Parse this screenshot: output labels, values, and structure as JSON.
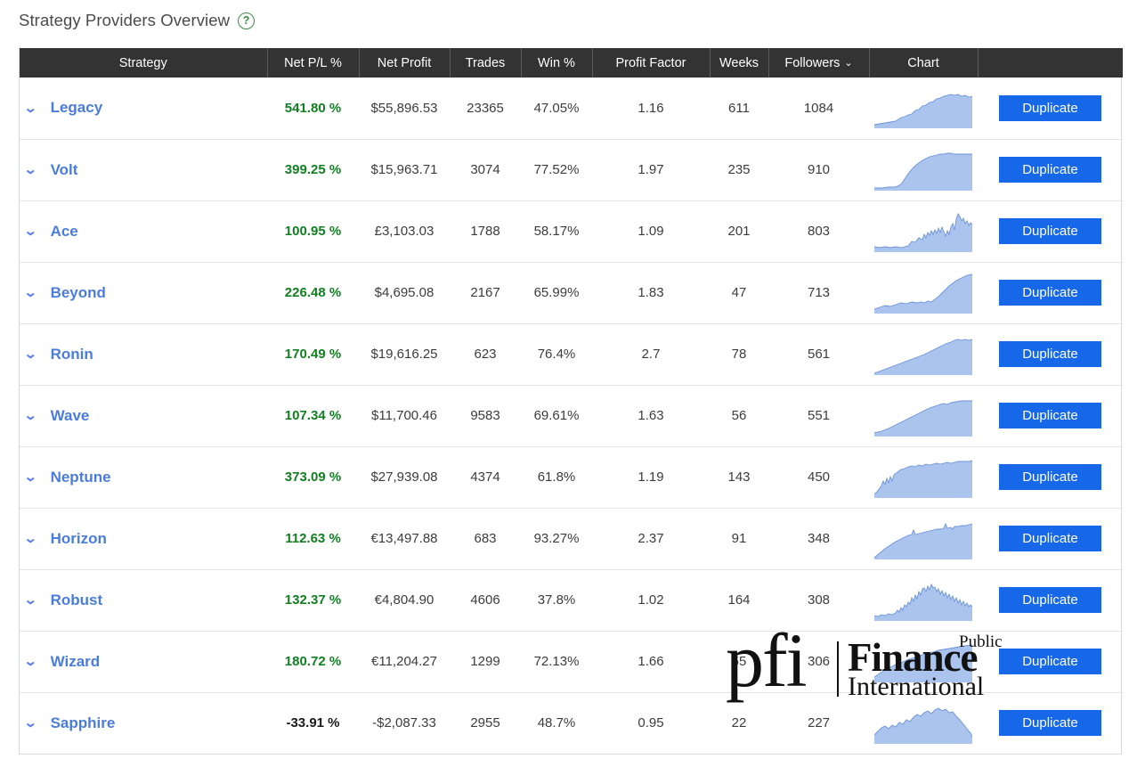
{
  "header": {
    "title": "Strategy Providers Overview",
    "help_icon": "question-circle-icon",
    "help_glyph": "?"
  },
  "table": {
    "columns": [
      {
        "key": "strategy",
        "label": "Strategy",
        "sortable": true,
        "caret": ""
      },
      {
        "key": "net_pl_pct",
        "label": "Net P/L %",
        "sortable": true,
        "caret": ""
      },
      {
        "key": "net_profit",
        "label": "Net Profit",
        "sortable": true,
        "caret": ""
      },
      {
        "key": "trades",
        "label": "Trades",
        "sortable": true,
        "caret": ""
      },
      {
        "key": "win_pct",
        "label": "Win %",
        "sortable": true,
        "caret": ""
      },
      {
        "key": "profit_factor",
        "label": "Profit Factor",
        "sortable": true,
        "caret": ""
      },
      {
        "key": "weeks",
        "label": "Weeks",
        "sortable": true,
        "caret": ""
      },
      {
        "key": "followers",
        "label": "Followers",
        "sortable": true,
        "caret": "⌄"
      },
      {
        "key": "chart",
        "label": "Chart",
        "sortable": false,
        "caret": ""
      },
      {
        "key": "action",
        "label": "",
        "sortable": false,
        "caret": ""
      }
    ],
    "sorted_by": "Followers",
    "sort_direction": "descending",
    "expand_glyph": "⌄",
    "duplicate_label": "Duplicate",
    "rows": [
      {
        "strategy": "Legacy",
        "net_pl_pct": "541.80 %",
        "net_pl_positive": true,
        "net_profit": "$55,896.53",
        "trades": "23365",
        "win_pct": "47.05%",
        "profit_factor": "1.16",
        "weeks": "611",
        "followers": "1084",
        "spark": "0,42 6,41 12,40 18,39 24,38 30,34 34,33 38,31 42,30 46,26 50,25 54,21 58,20 62,17 66,16 70,13 74,12 78,10 82,9 86,8 90,9 94,8 98,10 102,9 106,11 110,10"
      },
      {
        "strategy": "Volt",
        "net_pl_pct": "399.25 %",
        "net_pl_positive": true,
        "net_profit": "$15,963.71",
        "trades": "3074",
        "win_pct": "77.52%",
        "profit_factor": "1.97",
        "weeks": "235",
        "followers": "910",
        "spark": "0,43 8,43 16,42 22,42 26,41 30,39 34,33 38,27 42,22 46,18 50,15 54,12 58,10 62,8 66,7 70,6 74,5 78,5 82,4 86,4 90,5 96,5 102,5 110,5"
      },
      {
        "strategy": "Ace",
        "net_pl_pct": "100.95 %",
        "net_pl_positive": true,
        "net_profit": "£3,103.03",
        "trades": "1788",
        "win_pct": "58.17%",
        "profit_factor": "1.09",
        "weeks": "201",
        "followers": "803",
        "spark": "0,40 6,41 12,40 18,41 24,40 30,41 34,40 38,39 42,34 46,35 50,30 54,32 56,26 58,30 60,24 62,27 64,22 66,26 68,21 70,25 72,19 74,24 76,18 78,23 80,28 82,22 84,26 86,18 88,14 90,21 92,9 94,3 96,6 98,11 100,8 102,14 104,11 106,16 108,13 110,15"
      },
      {
        "strategy": "Beyond",
        "net_pl_pct": "226.48 %",
        "net_pl_positive": true,
        "net_profit": "$4,695.08",
        "trades": "2167",
        "win_pct": "65.99%",
        "profit_factor": "1.83",
        "weeks": "47",
        "followers": "713",
        "spark": "0,41 6,39 12,37 18,38 24,36 30,34 36,35 42,33 48,34 52,33 56,34 60,32 64,33 68,30 72,27 76,23 80,19 84,15 88,12 92,9 96,7 100,5 104,3 110,2"
      },
      {
        "strategy": "Ronin",
        "net_pl_pct": "170.49 %",
        "net_pl_positive": true,
        "net_profit": "$19,616.25",
        "trades": "623",
        "win_pct": "76.4%",
        "profit_factor": "2.7",
        "weeks": "78",
        "followers": "561",
        "spark": "0,44 8,41 16,38 24,35 32,32 40,29 48,26 56,23 62,20 68,17 74,14 80,11 86,9 90,7 94,6 98,7 102,6 106,7 110,6"
      },
      {
        "strategy": "Wave",
        "net_pl_pct": "107.34 %",
        "net_pl_positive": true,
        "net_profit": "$11,700.46",
        "trades": "9583",
        "win_pct": "69.61%",
        "profit_factor": "1.63",
        "weeks": "56",
        "followers": "551",
        "spark": "0,42 8,40 16,37 24,33 32,29 40,25 48,21 56,17 62,14 68,12 74,10 78,9 82,10 86,8 92,7 98,6 104,6 110,6"
      },
      {
        "strategy": "Neptune",
        "net_pl_pct": "373.09 %",
        "net_pl_positive": true,
        "net_profit": "$27,939.08",
        "trades": "4374",
        "win_pct": "61.8%",
        "profit_factor": "1.19",
        "weeks": "143",
        "followers": "450",
        "spark": "0,42 4,38 8,32 10,27 12,31 14,24 16,29 18,22 20,27 22,20 26,17 30,14 34,13 38,11 42,10 46,11 50,9 54,10 58,8 62,9 66,8 70,7 74,8 78,7 82,6 86,7 90,6 94,5 100,5 106,5 110,4"
      },
      {
        "strategy": "Horizon",
        "net_pl_pct": "112.63 %",
        "net_pl_positive": true,
        "net_profit": "€13,497.88",
        "trades": "683",
        "win_pct": "93.27%",
        "profit_factor": "2.37",
        "weeks": "91",
        "followers": "348",
        "spark": "0,44 6,39 12,34 18,30 24,26 30,23 34,21 38,19 42,18 44,13 46,18 50,17 54,16 58,15 62,14 66,13 70,12 74,12 78,11 80,6 82,11 86,10 88,12 90,9 94,9 98,8 102,8 106,7 110,6"
      },
      {
        "strategy": "Robust",
        "net_pl_pct": "132.37 %",
        "net_pl_positive": true,
        "net_profit": "€4,804.90",
        "trades": "4606",
        "win_pct": "37.8%",
        "profit_factor": "1.02",
        "weeks": "164",
        "followers": "308",
        "spark": "0,40 4,41 8,39 12,40 16,38 20,39 24,37 26,34 28,36 30,31 32,34 34,28 36,30 38,25 40,27 42,20 44,24 46,17 48,21 50,13 52,17 54,10 56,9 58,13 60,7 62,11 64,5 66,9 68,8 70,13 72,10 74,16 76,12 78,18 80,14 82,20 84,16 86,22 88,18 90,24 92,20 94,26 96,22 98,28 100,24 102,29 104,26 106,30 108,28 110,30"
      },
      {
        "strategy": "Wizard",
        "net_pl_pct": "180.72 %",
        "net_pl_positive": true,
        "net_profit": "€11,204.27",
        "trades": "1299",
        "win_pct": "72.13%",
        "profit_factor": "1.66",
        "weeks": "55",
        "followers": "306",
        "spark": "0,40 6,36 12,32 18,29 24,26 30,24 36,21 42,19 48,17 54,15 60,13 66,12 72,10 78,9 84,8 90,7 96,6 102,5 110,4"
      },
      {
        "strategy": "Sapphire",
        "net_pl_pct": "-33.91 %",
        "net_pl_positive": false,
        "net_profit": "-$2,087.33",
        "trades": "2955",
        "win_pct": "48.7%",
        "profit_factor": "0.95",
        "weeks": "22",
        "followers": "227",
        "spark": "0,36 4,32 8,28 12,26 16,29 20,25 24,27 28,22 32,24 36,19 40,21 44,16 48,13 52,15 56,11 60,9 64,12 68,8 72,6 76,9 80,7 84,11 88,10 92,15 96,19 100,24 104,29 108,34 110,38"
      }
    ]
  },
  "watermark": {
    "mark": "pfi",
    "line1": "Finance",
    "line2": "International",
    "tag": "Public"
  },
  "colors": {
    "header_bg": "#333333",
    "positive": "#118022",
    "negative": "#1a1a1a",
    "strategy_link": "#4a7ddb",
    "chevron": "#5c7cfa",
    "button": "#1668e8",
    "spark_fill": "#aac4ee",
    "spark_stroke": "#6b93d8",
    "help": "#3d8b47"
  }
}
